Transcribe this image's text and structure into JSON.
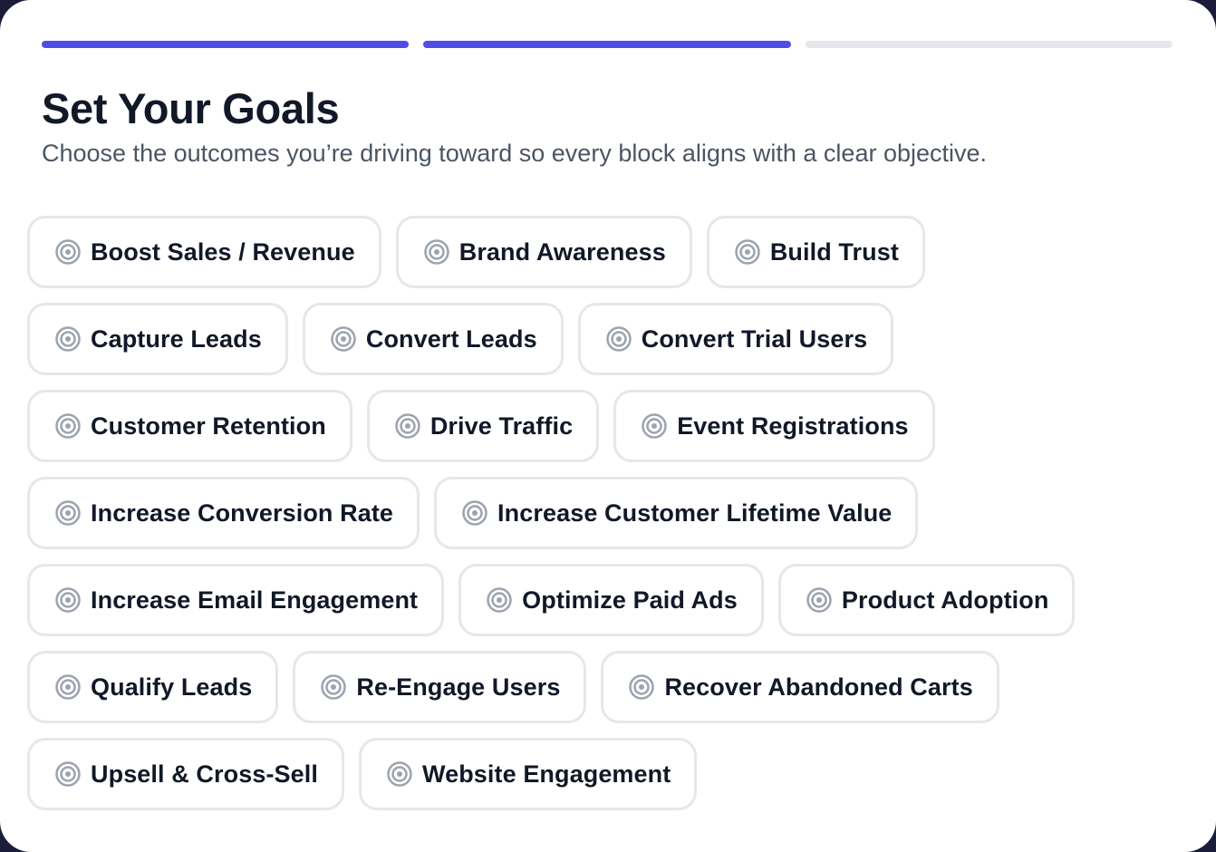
{
  "header": {
    "title": "Set Your Goals",
    "subtitle": "Choose the outcomes you’re driving toward so every block aligns with a clear objective."
  },
  "progress": {
    "total_steps": 3,
    "completed_steps": 2,
    "active_color": "#4f4de6",
    "inactive_color": "#e6e7ec"
  },
  "goal_icon": "target-icon",
  "goal_rows": [
    [
      "Boost Sales / Revenue",
      "Brand Awareness",
      "Build Trust"
    ],
    [
      "Capture Leads",
      "Convert Leads",
      "Convert Trial Users"
    ],
    [
      "Customer Retention",
      "Drive Traffic",
      "Event Registrations"
    ],
    [
      "Increase Conversion Rate",
      "Increase Customer Lifetime Value"
    ],
    [
      "Increase Email Engagement",
      "Optimize Paid Ads",
      "Product Adoption"
    ],
    [
      "Qualify Leads",
      "Re-Engage Users",
      "Recover Abandoned Carts"
    ],
    [
      "Upsell & Cross-Sell",
      "Website Engagement"
    ]
  ]
}
